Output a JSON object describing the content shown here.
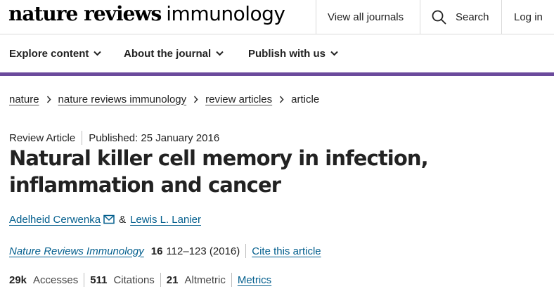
{
  "header": {
    "logo_bold": "nature reviews",
    "logo_light": "immunology",
    "view_all_journals": "View all journals",
    "search_label": "Search",
    "login_label": "Log in"
  },
  "nav": {
    "items": [
      {
        "label": "Explore content"
      },
      {
        "label": "About the journal"
      },
      {
        "label": "Publish with us"
      }
    ],
    "accent_color": "#6b4a9c"
  },
  "breadcrumb": {
    "items": [
      "nature",
      "nature reviews immunology",
      "review articles"
    ],
    "current": "article"
  },
  "article": {
    "type": "Review Article",
    "published": "Published: 25 January 2016",
    "title": "Natural killer cell memory in infection, inflammation and cancer",
    "authors": [
      {
        "name": "Adelheid Cerwenka"
      },
      {
        "name": "Lewis L. Lanier"
      }
    ],
    "author_separator": "&",
    "journal": "Nature Reviews Immunology",
    "volume": "16",
    "pages_year": "112–123 (2016)",
    "cite_label": "Cite this article",
    "link_color": "#025e8d"
  },
  "metrics": {
    "accesses_value": "29k",
    "accesses_label": "Accesses",
    "citations_value": "511",
    "citations_label": "Citations",
    "altmetric_value": "21",
    "altmetric_label": "Altmetric",
    "metrics_link": "Metrics"
  },
  "icons": {
    "search": "search-icon",
    "chevron": "chevron-down-icon",
    "breadcrumb_sep": "chevron-right-icon",
    "mail": "mail-icon"
  }
}
